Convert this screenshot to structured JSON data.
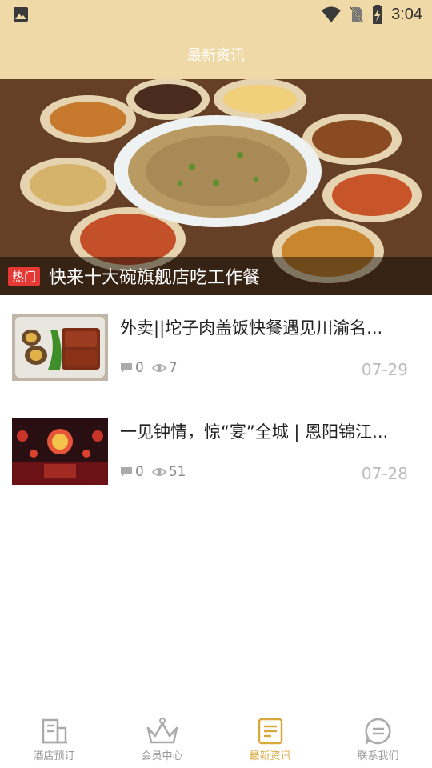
{
  "status_bar": {
    "time": "3:04"
  },
  "header": {
    "title": "最新资讯"
  },
  "banner": {
    "badge": "热门",
    "title": "快来十大碗旗舰店吃工作餐"
  },
  "news": [
    {
      "title": "外卖||坨子肉盖饭快餐遇见川渝名...",
      "comments": "0",
      "views": "7",
      "date": "07-29"
    },
    {
      "title": "一见钟情，惊“宴”全城 | 恩阳锦江...",
      "comments": "0",
      "views": "51",
      "date": "07-28"
    }
  ],
  "tabs": [
    {
      "label": "酒店预订",
      "icon": "building-icon",
      "active": false
    },
    {
      "label": "会员中心",
      "icon": "crown-icon",
      "active": false
    },
    {
      "label": "最新资讯",
      "icon": "news-doc-icon",
      "active": true
    },
    {
      "label": "联系我们",
      "icon": "chat-icon",
      "active": false
    }
  ],
  "colors": {
    "header_bg": "#efd9a6",
    "accent": "#d9a93e",
    "hot_badge": "#e53935"
  }
}
